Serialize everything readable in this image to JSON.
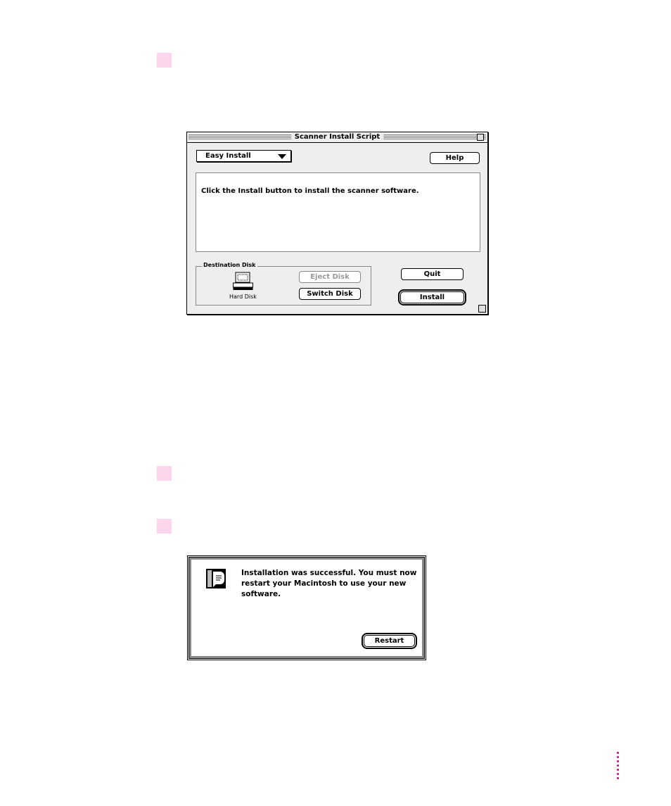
{
  "installer": {
    "title": "Scanner Install Script",
    "mode": "Easy Install",
    "help": "Help",
    "message": "Click the Install button to install the scanner software.",
    "destination_label": "Destination Disk",
    "disk_name": "Hard Disk",
    "eject": "Eject Disk",
    "switch": "Switch Disk",
    "quit": "Quit",
    "install": "Install"
  },
  "alert": {
    "message": "Installation was successful.  You must now restart your Macintosh to use your new software.",
    "restart": "Restart"
  },
  "colors": {
    "step_marker": "#fcd6ec",
    "page_dots": "#d4007a"
  }
}
